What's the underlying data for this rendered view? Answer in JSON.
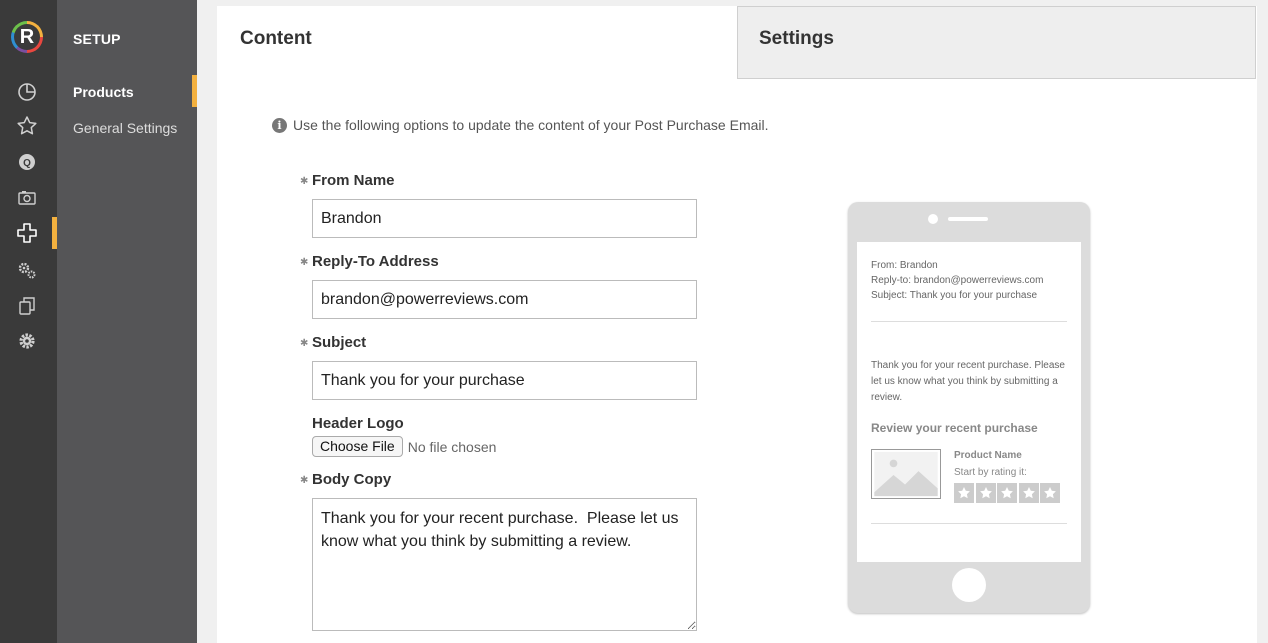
{
  "brand": {
    "logo_letter": "R"
  },
  "rail": {
    "icons": [
      "dashboard-icon",
      "star-icon",
      "qa-icon",
      "camera-icon",
      "plus-icon",
      "gears-icon",
      "copy-icon",
      "settings-icon"
    ],
    "active_index": 4,
    "accent_color": "#f4b13f"
  },
  "sidebar": {
    "title": "SETUP",
    "items": [
      {
        "label": "Products"
      },
      {
        "label": "General Settings"
      }
    ]
  },
  "tabs": [
    {
      "label": "Content"
    },
    {
      "label": "Settings"
    }
  ],
  "form": {
    "info_text": "Use the following options to update the content of your Post Purchase Email.",
    "from_name": {
      "label": "From Name",
      "value": "Brandon"
    },
    "reply_to": {
      "label": "Reply-To Address",
      "value": "brandon@powerreviews.com"
    },
    "subject": {
      "label": "Subject",
      "value": "Thank you for your purchase"
    },
    "header_logo": {
      "label": "Header Logo",
      "button": "Choose File",
      "status": "No file chosen"
    },
    "body_copy": {
      "label": "Body Copy",
      "value": "Thank you for your recent purchase.  Please let us know what you think by submitting a review."
    }
  },
  "preview": {
    "from": "From: Brandon",
    "reply_to": "Reply-to: brandon@powerreviews.com",
    "subject": "Subject: Thank you for your purchase",
    "body": "Thank you for your recent purchase. Please let us know what you think by submitting a review.",
    "heading": "Review your recent purchase",
    "product_name": "Product Name",
    "rating_prompt": "Start by rating it:",
    "stars": 5
  }
}
